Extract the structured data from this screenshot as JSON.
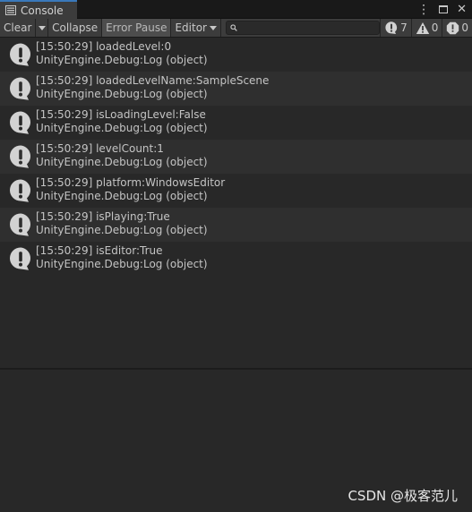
{
  "window": {
    "tab_title": "Console"
  },
  "toolbar": {
    "clear_label": "Clear",
    "collapse_label": "Collapse",
    "error_pause_label": "Error Pause",
    "editor_label": "Editor",
    "search_value": "",
    "log_count": "7",
    "warning_count": "0",
    "error_count": "0"
  },
  "logs": [
    {
      "line1": "[15:50:29] loadedLevel:0",
      "line2": "UnityEngine.Debug:Log (object)"
    },
    {
      "line1": "[15:50:29] loadedLevelName:SampleScene",
      "line2": "UnityEngine.Debug:Log (object)"
    },
    {
      "line1": "[15:50:29] isLoadingLevel:False",
      "line2": "UnityEngine.Debug:Log (object)"
    },
    {
      "line1": "[15:50:29] levelCount:1",
      "line2": "UnityEngine.Debug:Log (object)"
    },
    {
      "line1": "[15:50:29] platform:WindowsEditor",
      "line2": "UnityEngine.Debug:Log (object)"
    },
    {
      "line1": "[15:50:29] isPlaying:True",
      "line2": "UnityEngine.Debug:Log (object)"
    },
    {
      "line1": "[15:50:29] isEditor:True",
      "line2": "UnityEngine.Debug:Log (object)"
    }
  ],
  "watermark": "CSDN @极客范儿",
  "icons": {
    "tab": "console-list-icon",
    "log": "info-speech-bubble-icon",
    "warning": "warning-triangle-icon",
    "error": "error-octagon-icon"
  },
  "colors": {
    "background": "#282828",
    "alt_row": "#2f2f2f",
    "toolbar": "#3c3c3c",
    "tab_accent": "#3a79bb",
    "text": "#c4c4c4",
    "icon": "#d2d2d2"
  }
}
